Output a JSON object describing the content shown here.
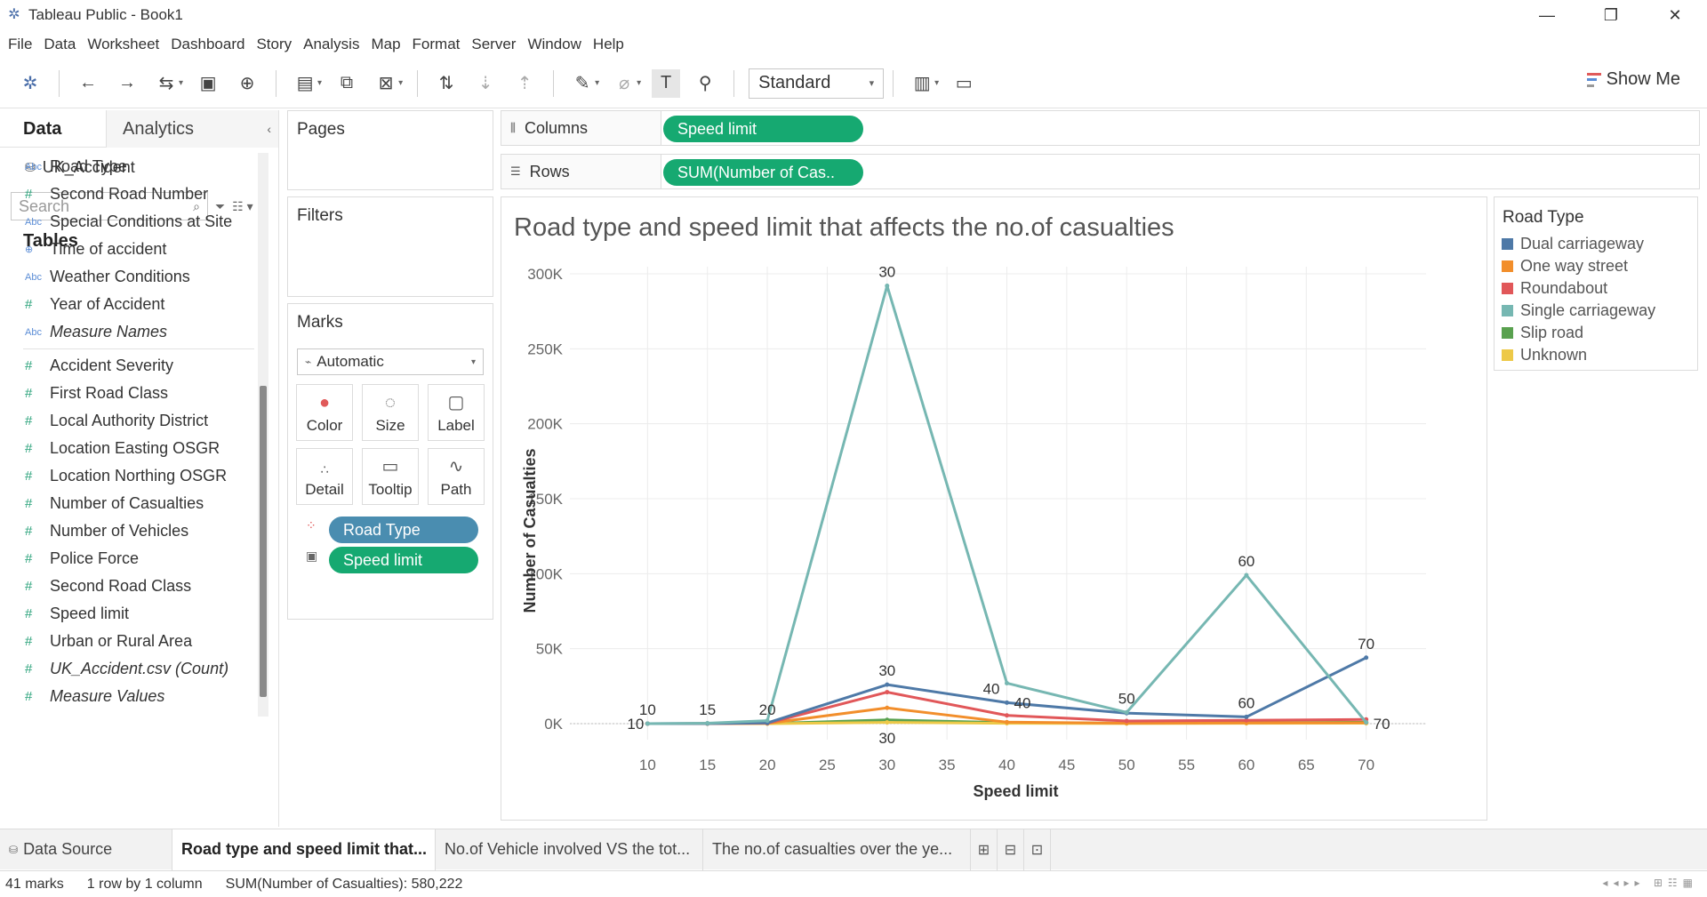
{
  "window": {
    "title": "Tableau Public - Book1",
    "minimize": "—",
    "restore": "❐",
    "close": "✕"
  },
  "menu": [
    "File",
    "Data",
    "Worksheet",
    "Dashboard",
    "Story",
    "Analysis",
    "Map",
    "Format",
    "Server",
    "Window",
    "Help"
  ],
  "toolbar": {
    "mark_type": "Standard",
    "show_me": "Show Me"
  },
  "data_pane": {
    "tab_data": "Data",
    "tab_analytics": "Analytics",
    "datasource": "UK_Accident",
    "search_placeholder": "Search",
    "tables_label": "Tables",
    "fields": [
      {
        "type": "Abc",
        "name": "Road Type"
      },
      {
        "type": "#",
        "name": "Second Road Number"
      },
      {
        "type": "Abc",
        "name": "Special Conditions at Site"
      },
      {
        "type": "⊕",
        "name": "Time of accident"
      },
      {
        "type": "Abc",
        "name": "Weather Conditions"
      },
      {
        "type": "#",
        "name": "Year of Accident"
      },
      {
        "type": "Abc",
        "name": "Measure Names"
      },
      {
        "type": "#",
        "name": "Accident Severity"
      },
      {
        "type": "#",
        "name": "First Road Class"
      },
      {
        "type": "#",
        "name": "Local Authority District"
      },
      {
        "type": "#",
        "name": "Location Easting OSGR"
      },
      {
        "type": "#",
        "name": "Location Northing OSGR"
      },
      {
        "type": "#",
        "name": "Number of Casualties"
      },
      {
        "type": "#",
        "name": "Number of Vehicles"
      },
      {
        "type": "#",
        "name": "Police Force"
      },
      {
        "type": "#",
        "name": "Second Road Class"
      },
      {
        "type": "#",
        "name": "Speed limit"
      },
      {
        "type": "#",
        "name": "Urban or Rural Area"
      },
      {
        "type": "#",
        "name": "UK_Accident.csv (Count)"
      },
      {
        "type": "#",
        "name": "Measure Values"
      }
    ]
  },
  "cards": {
    "pages": "Pages",
    "filters": "Filters",
    "marks": "Marks",
    "marks_type": "Automatic",
    "mark_buttons": [
      "Color",
      "Size",
      "Label",
      "Detail",
      "Tooltip",
      "Path"
    ],
    "mark_pills": [
      "Road Type",
      "Speed limit"
    ]
  },
  "shelves": {
    "columns_label": "Columns",
    "columns_pill": "Speed limit",
    "rows_label": "Rows",
    "rows_pill": "SUM(Number of Cas.."
  },
  "legend": {
    "title": "Road Type",
    "items": [
      {
        "name": "Dual carriageway",
        "color": "#4e79a7"
      },
      {
        "name": "One way street",
        "color": "#f28e2b"
      },
      {
        "name": "Roundabout",
        "color": "#e15759"
      },
      {
        "name": "Single carriageway",
        "color": "#76b7b2"
      },
      {
        "name": "Slip road",
        "color": "#59a14f"
      },
      {
        "name": "Unknown",
        "color": "#edc948"
      }
    ]
  },
  "chart_data": {
    "type": "line",
    "title": "Road type and speed limit that affects the no.of casualties",
    "xlabel": "Speed limit",
    "ylabel": "Number of Casualties",
    "x_ticks": [
      10,
      15,
      20,
      25,
      30,
      35,
      40,
      45,
      50,
      55,
      60,
      65,
      70
    ],
    "y_ticks": [
      "0K",
      "50K",
      "100K",
      "150K",
      "200K",
      "250K",
      "300K"
    ],
    "xlim": [
      5,
      75
    ],
    "ylim": [
      0,
      300000
    ],
    "x": [
      10,
      15,
      20,
      30,
      40,
      50,
      60,
      70
    ],
    "series": [
      {
        "name": "Dual carriageway",
        "color": "#4e79a7",
        "x": [
          10,
          15,
          20,
          30,
          40,
          50,
          60,
          70
        ],
        "values": [
          0,
          100,
          500,
          26000,
          14000,
          7000,
          4500,
          44000
        ]
      },
      {
        "name": "One way street",
        "color": "#f28e2b",
        "x": [
          10,
          15,
          20,
          30,
          40,
          50,
          60,
          70
        ],
        "values": [
          0,
          50,
          200,
          10500,
          1000,
          300,
          500,
          600
        ]
      },
      {
        "name": "Roundabout",
        "color": "#e15759",
        "x": [
          10,
          15,
          20,
          30,
          40,
          50,
          60,
          70
        ],
        "values": [
          0,
          50,
          300,
          21000,
          5500,
          1800,
          2200,
          2800
        ]
      },
      {
        "name": "Single carriageway",
        "color": "#76b7b2",
        "x": [
          10,
          15,
          20,
          30,
          40,
          50,
          60,
          70
        ],
        "values": [
          0,
          300,
          2000,
          292000,
          27000,
          7500,
          99000,
          800
        ]
      },
      {
        "name": "Slip road",
        "color": "#59a14f",
        "x": [
          10,
          15,
          20,
          30,
          40,
          50,
          60,
          70
        ],
        "values": [
          0,
          0,
          50,
          2500,
          700,
          300,
          700,
          900
        ]
      },
      {
        "name": "Unknown",
        "color": "#edc948",
        "x": [
          10,
          15,
          20,
          30,
          40,
          50,
          60,
          70
        ],
        "values": [
          0,
          0,
          20,
          800,
          200,
          100,
          200,
          300
        ]
      }
    ],
    "labels": [
      {
        "text": "10",
        "x": 10,
        "y": 0,
        "pos": "left"
      },
      {
        "text": "10",
        "x": 10,
        "y": 0,
        "pos": "above"
      },
      {
        "text": "15",
        "x": 15,
        "y": 0,
        "pos": "above"
      },
      {
        "text": "20",
        "x": 20,
        "y": 0,
        "pos": "above"
      },
      {
        "text": "30",
        "x": 30,
        "y": 292000,
        "pos": "above"
      },
      {
        "text": "30",
        "x": 30,
        "y": 26000,
        "pos": "above"
      },
      {
        "text": "30",
        "x": 30,
        "y": 0,
        "pos": "below"
      },
      {
        "text": "40",
        "x": 40,
        "y": 14000,
        "pos": "above-left"
      },
      {
        "text": "40",
        "x": 40,
        "y": 14000,
        "pos": "right"
      },
      {
        "text": "50",
        "x": 50,
        "y": 7500,
        "pos": "above"
      },
      {
        "text": "60",
        "x": 60,
        "y": 99000,
        "pos": "above"
      },
      {
        "text": "60",
        "x": 60,
        "y": 4500,
        "pos": "above"
      },
      {
        "text": "70",
        "x": 70,
        "y": 44000,
        "pos": "above"
      },
      {
        "text": "70",
        "x": 70,
        "y": 0,
        "pos": "right"
      }
    ],
    "grid": true,
    "legend": "right"
  },
  "sheets": {
    "data_source": "Data Source",
    "tabs": [
      "Road type and speed limit that...",
      "No.of Vehicle involved VS the tot...",
      "The no.of casualties over the ye..."
    ]
  },
  "status": {
    "marks": "41 marks",
    "dims": "1 row by 1 column",
    "sum": "SUM(Number of Casualties): 580,222"
  }
}
